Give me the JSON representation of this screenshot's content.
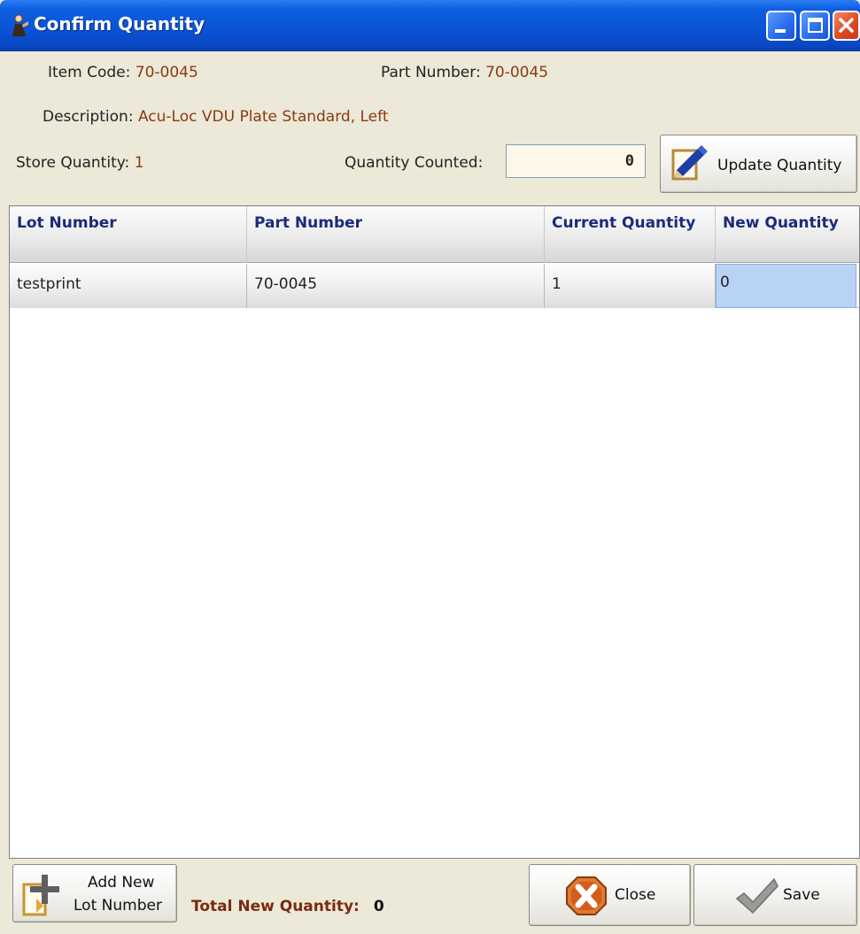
{
  "window": {
    "title": "Confirm Quantity",
    "controls": [
      "minimize",
      "maximize",
      "close"
    ]
  },
  "header": {
    "item_code_label": "Item Code:",
    "item_code_value": "70-0045",
    "part_number_label": "Part Number:",
    "part_number_value": "70-0045",
    "description_label": "Description:",
    "description_value": "Acu-Loc VDU Plate Standard, Left",
    "store_quantity_label": "Store Quantity:",
    "store_quantity_value": "1",
    "quantity_counted_label": "Quantity Counted:",
    "quantity_counted_value": "0",
    "update_button_label": "Update Quantity"
  },
  "grid": {
    "columns": [
      "Lot Number",
      "Part Number",
      "Current Quantity",
      "New Quantity"
    ],
    "rows": [
      {
        "lot_number": "testprint",
        "part_number": "70-0045",
        "current_quantity": "1",
        "new_quantity": "0"
      }
    ]
  },
  "footer": {
    "add_lot_label_line1": "Add New",
    "add_lot_label_line2": "Lot Number",
    "total_label": "Total New Quantity:",
    "total_value": "0",
    "close_label": "Close",
    "save_label": "Save"
  },
  "colors": {
    "titlebar": "#0a52d3",
    "value_text": "#8b3a12",
    "header_text": "#1b2a7b",
    "selected_cell": "#b9d3f5",
    "input_bg": "#fdf7e7"
  }
}
